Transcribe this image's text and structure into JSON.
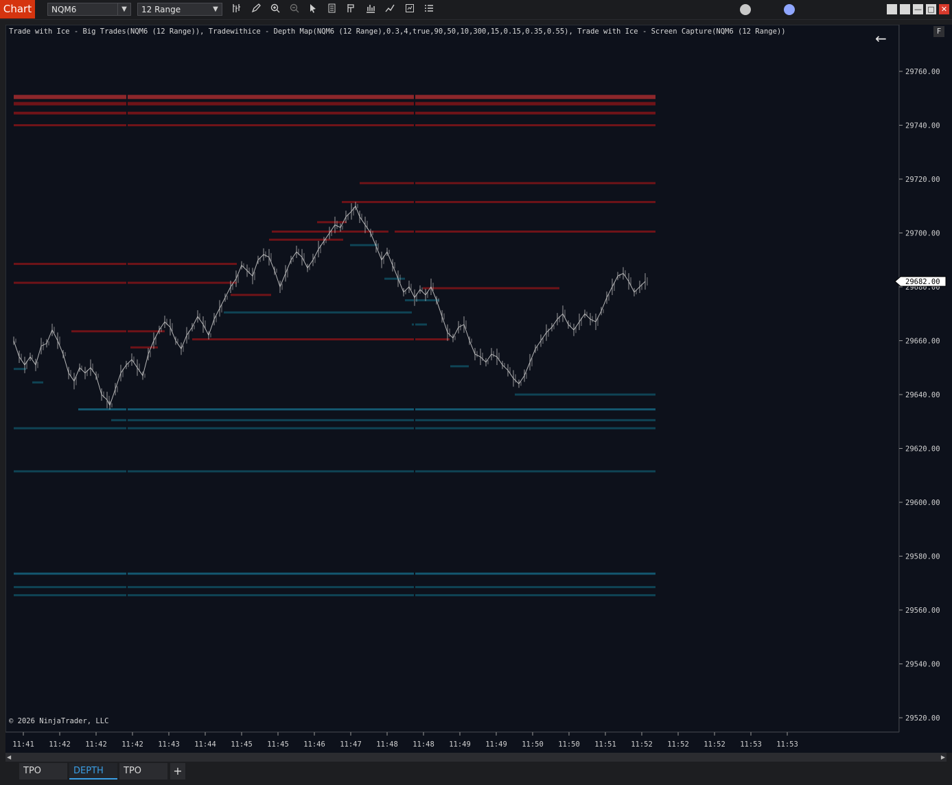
{
  "toolbar": {
    "app_label": "Chart",
    "instrument": "NQM6",
    "interval": "12 Range",
    "tool_icons": [
      "bar-type-icon",
      "draw-pencil-icon",
      "zoom-in-icon",
      "zoom-out-icon",
      "pointer-icon",
      "data-box-icon",
      "properties-icon",
      "strategies-icon",
      "indicators-icon",
      "chart-trader-icon",
      "templates-icon"
    ]
  },
  "chart": {
    "indicator_line": "Trade with Ice - Big Trades(NQM6 (12 Range)), Tradewithice - Depth Map(NQM6 (12 Range),0.3,4,true,90,50,10,300,15,0.15,0.35,0.55), Trade with Ice - Screen Capture(NQM6 (12 Range))",
    "copyright": "© 2026 NinjaTrader, LLC",
    "f_button": "F",
    "colors": {
      "background": "#0d111b",
      "ask_liquidity": "#7a1418",
      "ask_liquidity_light": "#9b2a2e",
      "bid_liquidity": "#0f4a5c",
      "bid_liquidity_light": "#15607a",
      "candle": "#c9c9c9",
      "current_price_bg": "#ffffff"
    }
  },
  "chart_data": {
    "type": "line",
    "instrument": "NQM6",
    "y_ticks": [
      "29760.00",
      "29740.00",
      "29720.00",
      "29700.00",
      "29680.00",
      "29660.00",
      "29640.00",
      "29620.00",
      "29600.00",
      "29580.00",
      "29560.00",
      "29540.00",
      "29520.00"
    ],
    "ylim": [
      29515,
      29776
    ],
    "current_price": "29682.00",
    "x_ticks": [
      "11:41",
      "11:42",
      "11:42",
      "11:42",
      "11:43",
      "11:44",
      "11:45",
      "11:45",
      "11:46",
      "11:47",
      "11:48",
      "11:48",
      "11:49",
      "11:49",
      "11:50",
      "11:50",
      "11:51",
      "11:52",
      "11:52",
      "11:52",
      "11:53",
      "11:53"
    ],
    "price_path": [
      [
        0,
        29660
      ],
      [
        8,
        29654
      ],
      [
        16,
        29651
      ],
      [
        24,
        29654
      ],
      [
        32,
        29651
      ],
      [
        40,
        29658
      ],
      [
        48,
        29659
      ],
      [
        56,
        29664
      ],
      [
        64,
        29660
      ],
      [
        72,
        29655
      ],
      [
        80,
        29648
      ],
      [
        88,
        29645
      ],
      [
        96,
        29650
      ],
      [
        104,
        29648
      ],
      [
        112,
        29650
      ],
      [
        120,
        29647
      ],
      [
        128,
        29640
      ],
      [
        136,
        29638
      ],
      [
        140,
        29636
      ],
      [
        148,
        29642
      ],
      [
        156,
        29648
      ],
      [
        164,
        29651
      ],
      [
        172,
        29653
      ],
      [
        180,
        29650
      ],
      [
        188,
        29647
      ],
      [
        196,
        29655
      ],
      [
        204,
        29660
      ],
      [
        212,
        29664
      ],
      [
        220,
        29667
      ],
      [
        228,
        29665
      ],
      [
        236,
        29660
      ],
      [
        244,
        29657
      ],
      [
        252,
        29662
      ],
      [
        260,
        29665
      ],
      [
        268,
        29669
      ],
      [
        276,
        29666
      ],
      [
        284,
        29662
      ],
      [
        292,
        29668
      ],
      [
        300,
        29672
      ],
      [
        308,
        29676
      ],
      [
        316,
        29680
      ],
      [
        324,
        29683
      ],
      [
        332,
        29688
      ],
      [
        340,
        29686
      ],
      [
        348,
        29684
      ],
      [
        356,
        29690
      ],
      [
        364,
        29692
      ],
      [
        372,
        29691
      ],
      [
        380,
        29686
      ],
      [
        388,
        29680
      ],
      [
        396,
        29685
      ],
      [
        404,
        29690
      ],
      [
        412,
        29693
      ],
      [
        420,
        29691
      ],
      [
        428,
        29687
      ],
      [
        436,
        29690
      ],
      [
        444,
        29694
      ],
      [
        452,
        29697
      ],
      [
        460,
        29700
      ],
      [
        468,
        29703
      ],
      [
        476,
        29702
      ],
      [
        484,
        29706
      ],
      [
        492,
        29708
      ],
      [
        498,
        29710
      ],
      [
        504,
        29706
      ],
      [
        512,
        29703
      ],
      [
        520,
        29700
      ],
      [
        528,
        29695
      ],
      [
        536,
        29690
      ],
      [
        544,
        29693
      ],
      [
        552,
        29688
      ],
      [
        560,
        29683
      ],
      [
        568,
        29678
      ],
      [
        576,
        29680
      ],
      [
        584,
        29676
      ],
      [
        592,
        29679
      ],
      [
        600,
        29677
      ],
      [
        608,
        29680
      ],
      [
        616,
        29675
      ],
      [
        624,
        29669
      ],
      [
        632,
        29663
      ],
      [
        640,
        29661
      ],
      [
        648,
        29665
      ],
      [
        656,
        29666
      ],
      [
        664,
        29660
      ],
      [
        672,
        29655
      ],
      [
        680,
        29654
      ],
      [
        688,
        29652
      ],
      [
        696,
        29655
      ],
      [
        704,
        29654
      ],
      [
        712,
        29651
      ],
      [
        720,
        29649
      ],
      [
        728,
        29646
      ],
      [
        736,
        29644
      ],
      [
        744,
        29647
      ],
      [
        752,
        29652
      ],
      [
        760,
        29657
      ],
      [
        768,
        29660
      ],
      [
        776,
        29663
      ],
      [
        784,
        29665
      ],
      [
        792,
        29668
      ],
      [
        800,
        29670
      ],
      [
        808,
        29666
      ],
      [
        816,
        29664
      ],
      [
        824,
        29667
      ],
      [
        832,
        29670
      ],
      [
        840,
        29668
      ],
      [
        848,
        29667
      ],
      [
        856,
        29671
      ],
      [
        864,
        29676
      ],
      [
        872,
        29680
      ],
      [
        880,
        29684
      ],
      [
        888,
        29685
      ],
      [
        896,
        29682
      ],
      [
        904,
        29678
      ],
      [
        912,
        29680
      ],
      [
        920,
        29682
      ]
    ]
  },
  "tabs": [
    {
      "label": "TPO"
    },
    {
      "label": "DEPTH"
    },
    {
      "label": "TPO"
    }
  ],
  "add_tab": "+"
}
